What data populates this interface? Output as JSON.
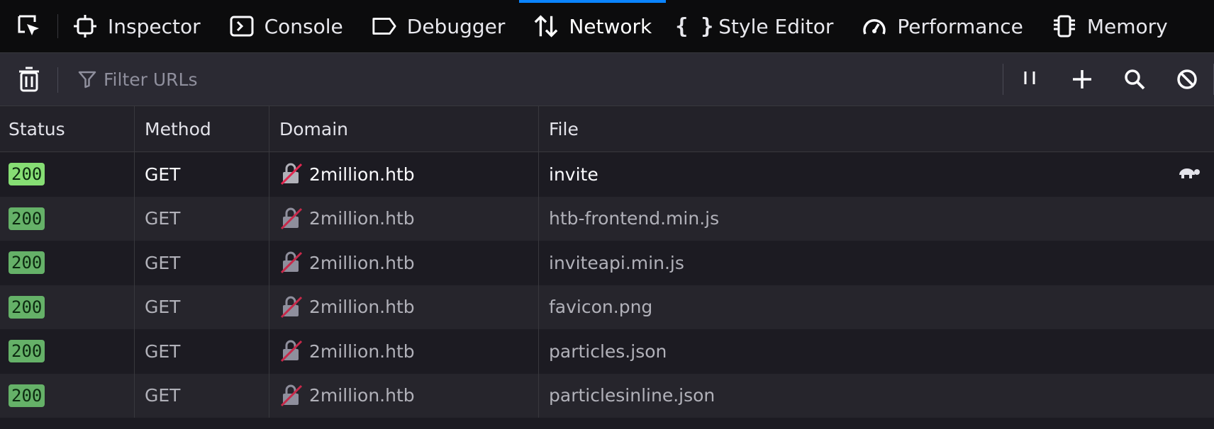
{
  "tabs": [
    {
      "label": "Inspector",
      "icon": "inspector-icon"
    },
    {
      "label": "Console",
      "icon": "console-icon"
    },
    {
      "label": "Debugger",
      "icon": "debugger-icon"
    },
    {
      "label": "Network",
      "icon": "network-icon",
      "active": true
    },
    {
      "label": "Style Editor",
      "icon": "style-editor-icon"
    },
    {
      "label": "Performance",
      "icon": "performance-icon"
    },
    {
      "label": "Memory",
      "icon": "memory-icon"
    }
  ],
  "toolbar": {
    "filter_placeholder": "Filter URLs",
    "icons": [
      "trash-icon",
      "filter-icon",
      "pause-icon",
      "add-icon",
      "search-icon",
      "block-icon"
    ]
  },
  "table": {
    "columns": [
      "Status",
      "Method",
      "Domain",
      "File"
    ],
    "rows": [
      {
        "status": "200",
        "method": "GET",
        "domain": "2million.htb",
        "file": "invite"
      },
      {
        "status": "200",
        "method": "GET",
        "domain": "2million.htb",
        "file": "htb-frontend.min.js"
      },
      {
        "status": "200",
        "method": "GET",
        "domain": "2million.htb",
        "file": "inviteapi.min.js"
      },
      {
        "status": "200",
        "method": "GET",
        "domain": "2million.htb",
        "file": "favicon.png"
      },
      {
        "status": "200",
        "method": "GET",
        "domain": "2million.htb",
        "file": "particles.json"
      },
      {
        "status": "200",
        "method": "GET",
        "domain": "2million.htb",
        "file": "particlesinline.json"
      }
    ]
  },
  "colors": {
    "accent": "#0a84ff",
    "status_ok": "#86de74",
    "insecure_lock": "#e22850"
  }
}
